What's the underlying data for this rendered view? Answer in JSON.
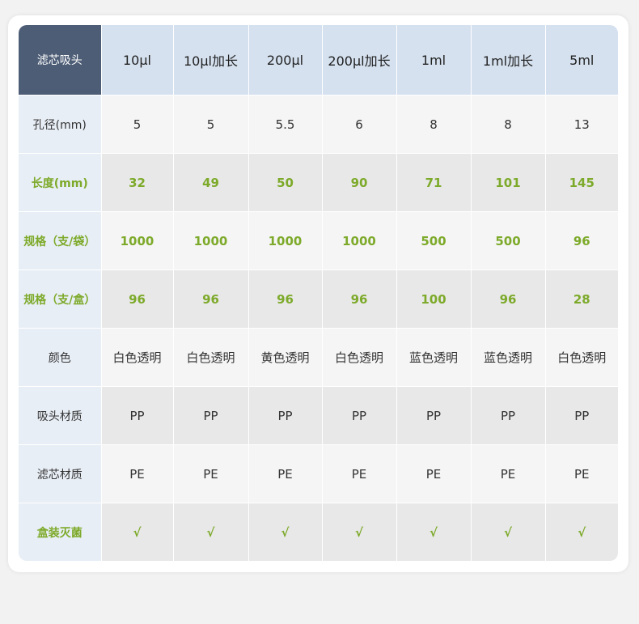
{
  "table": {
    "corner_label": "滤芯吸头",
    "columns": [
      "10µl",
      "10µl加长",
      "200µl",
      "200µl加长",
      "1ml",
      "1ml加长",
      "5ml"
    ],
    "rows": [
      {
        "label": "孔径(mm)",
        "values": [
          "5",
          "5",
          "5.5",
          "6",
          "8",
          "8",
          "13"
        ]
      },
      {
        "label": "长度(mm)",
        "values": [
          "32",
          "49",
          "50",
          "90",
          "71",
          "101",
          "145"
        ]
      },
      {
        "label": "规格（支/袋）",
        "values": [
          "1000",
          "1000",
          "1000",
          "1000",
          "500",
          "500",
          "96"
        ]
      },
      {
        "label": "规格（支/盒）",
        "values": [
          "96",
          "96",
          "96",
          "96",
          "100",
          "96",
          "28"
        ]
      },
      {
        "label": "颜色",
        "values": [
          "白色透明",
          "白色透明",
          "黄色透明",
          "白色透明",
          "蓝色透明",
          "蓝色透明",
          "白色透明"
        ]
      },
      {
        "label": "吸头材质",
        "values": [
          "PP",
          "PP",
          "PP",
          "PP",
          "PP",
          "PP",
          "PP"
        ]
      },
      {
        "label": "滤芯材质",
        "values": [
          "PE",
          "PE",
          "PE",
          "PE",
          "PE",
          "PE",
          "PE"
        ]
      },
      {
        "label": "盒装灭菌",
        "values": [
          "√",
          "√",
          "√",
          "√",
          "√",
          "√",
          "√"
        ]
      }
    ]
  },
  "colors": {
    "corner_bg": "#4d5d76",
    "header_bg": "#d5e1ef",
    "label_bg": "#e8eef6",
    "accent_green": "#7daa2a"
  }
}
